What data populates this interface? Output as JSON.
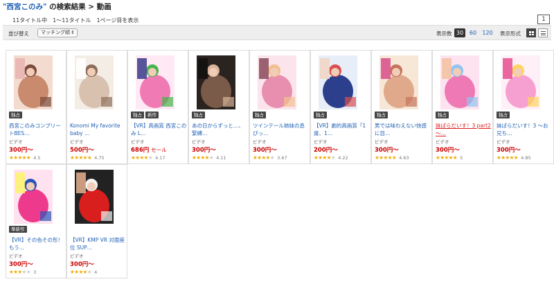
{
  "header": {
    "query": "\"西宮このみ\"",
    "title_rest": "の検索結果 > 動画"
  },
  "result_summary": "11タイトル中　1〜11タイトル　1ページ目を表示",
  "pagination": {
    "current_page": "1"
  },
  "toolbar": {
    "sort_label": "並び替え",
    "sort_value": "マッチング順",
    "display_count_label": "表示数",
    "display_counts": [
      "30",
      "60",
      "120"
    ],
    "active_count": "30",
    "display_format_label": "表示形式",
    "grid_icon": "grid-view-icon",
    "list_icon": "list-view-icon"
  },
  "colors": {
    "link": "#1d5fb4",
    "price": "#cc0000",
    "star": "#f2a900",
    "badge_bg": "#444444",
    "toolbar_bg": "#eeeeee"
  },
  "products": [
    {
      "title": "西宮このみコンプリートBES…",
      "badges": [
        "独占"
      ],
      "type": "ビデオ",
      "price": "300円〜",
      "sale": "",
      "rating": "4.5",
      "stars": 5,
      "title_red": false
    },
    {
      "title": "Konomi My favorite baby …",
      "badges": [],
      "type": "ビデオ",
      "price": "500円〜",
      "sale": "",
      "rating": "4.75",
      "stars": 5,
      "title_red": false
    },
    {
      "title": "【VR】高画質 西宮このみ L…",
      "badges": [
        "独占",
        "新作"
      ],
      "type": "ビデオ",
      "price": "686円",
      "sale": "セール",
      "rating": "4.17",
      "stars": 4,
      "title_red": false
    },
    {
      "title": "あの日からずっと…、緊縛…",
      "badges": [
        "独占"
      ],
      "type": "ビデオ",
      "price": "300円〜",
      "sale": "",
      "rating": "4.11",
      "stars": 4,
      "title_red": false
    },
    {
      "title": "ツインテール姉妹の息ぴっ…",
      "badges": [
        "独占"
      ],
      "type": "ビデオ",
      "price": "300円〜",
      "sale": "",
      "rating": "3.67",
      "stars": 4,
      "title_red": false
    },
    {
      "title": "【VR】劇的高画質「1度、1…",
      "badges": [
        "独占"
      ],
      "type": "ビデオ",
      "price": "200円〜",
      "sale": "",
      "rating": "4.22",
      "stars": 4,
      "title_red": false
    },
    {
      "title": "男では味わえない快感に目…",
      "badges": [
        "独占"
      ],
      "type": "ビデオ",
      "price": "300円〜",
      "sale": "",
      "rating": "4.63",
      "stars": 5,
      "title_red": false
    },
    {
      "title": "妹ぱらだいす！3 part2 〜…",
      "badges": [
        "独占"
      ],
      "type": "ビデオ",
      "price": "300円〜",
      "sale": "",
      "rating": "5",
      "stars": 5,
      "title_red": true
    },
    {
      "title": "妹ぱらだいす！3 〜お兄ち…",
      "badges": [
        "独占"
      ],
      "type": "ビデオ",
      "price": "300円〜",
      "sale": "",
      "rating": "4.85",
      "stars": 5,
      "title_red": false
    },
    {
      "title": "【VR】その色その形！もう…",
      "badges": [
        "準新作"
      ],
      "type": "ビデオ",
      "price": "300円〜",
      "sale": "",
      "rating": "3",
      "stars": 3,
      "title_red": false
    },
    {
      "title": "【VR】KMP VR 対面座位 SUP…",
      "badges": [],
      "type": "ビデオ",
      "price": "300円〜",
      "sale": "",
      "rating": "4",
      "stars": 4,
      "title_red": false
    }
  ],
  "thumb_palettes": [
    [
      "#f3dccf",
      "#c98a6e",
      "#7a4a3a",
      "#e8b3b0"
    ],
    [
      "#f4ede6",
      "#d9c1b0",
      "#8c6d5a",
      "#ffffff"
    ],
    [
      "#ffe9f4",
      "#f07ab3",
      "#46b44a",
      "#3a3a8c"
    ],
    [
      "#2b2320",
      "#7a5a48",
      "#d9b49a",
      "#111111"
    ],
    [
      "#fbe4ec",
      "#e88fb0",
      "#f2c08e",
      "#8a4a5a"
    ],
    [
      "#e8eef8",
      "#2b3f8c",
      "#d95050",
      "#f1d3c2"
    ],
    [
      "#f6e7d6",
      "#e0a98b",
      "#c6735a",
      "#d84b8c"
    ],
    [
      "#fde3ef",
      "#ee79b4",
      "#8ec5f0",
      "#f3c0a0"
    ],
    [
      "#fff0f8",
      "#f5a0d0",
      "#ffd45c",
      "#e84c8f"
    ],
    [
      "#ffe2ef",
      "#ee3a8c",
      "#2a55b8",
      "#fff36a"
    ],
    [
      "#222222",
      "#d91e1e",
      "#f3f3f3",
      "#e8b08f"
    ]
  ]
}
